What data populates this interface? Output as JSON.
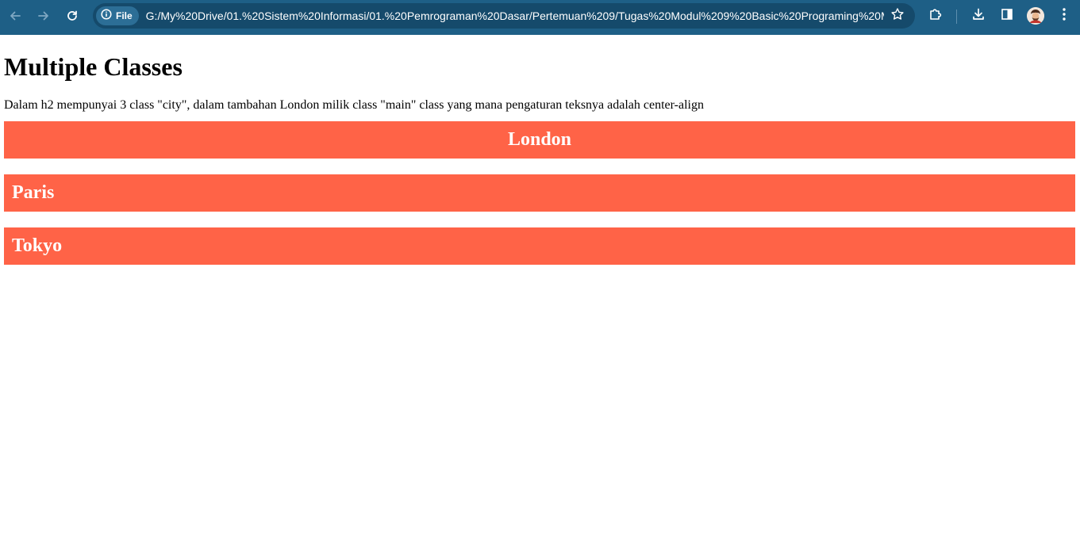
{
  "browser": {
    "site_chip_label": "File",
    "url": "G:/My%20Drive/01.%20Sistem%20Informasi/01.%20Pemrograman%20Dasar/Pertemuan%209/Tugas%20Modul%209%20Basic%20Programing%20M...",
    "icons": {
      "back": "arrow-left-icon",
      "forward": "arrow-right-icon",
      "reload": "reload-icon",
      "site_info": "info-icon",
      "bookmark": "star-icon",
      "extensions": "puzzle-icon",
      "downloads": "download-icon",
      "side_panel": "side-panel-icon",
      "profile": "avatar",
      "menu": "kebab-menu-icon"
    },
    "colors": {
      "toolbar": "#1e5f86",
      "omnibox": "#154a6b"
    }
  },
  "page": {
    "title": "Multiple Classes",
    "description": "Dalam h2 mempunyai 3 class \"city\", dalam tambahan London milik class \"main\" class yang mana pengaturan teksnya adalah center-align",
    "cities": [
      {
        "name": "London"
      },
      {
        "name": "Paris"
      },
      {
        "name": "Tokyo"
      }
    ],
    "colors": {
      "city_background": "#ff6347",
      "city_text": "#ffffff"
    }
  }
}
